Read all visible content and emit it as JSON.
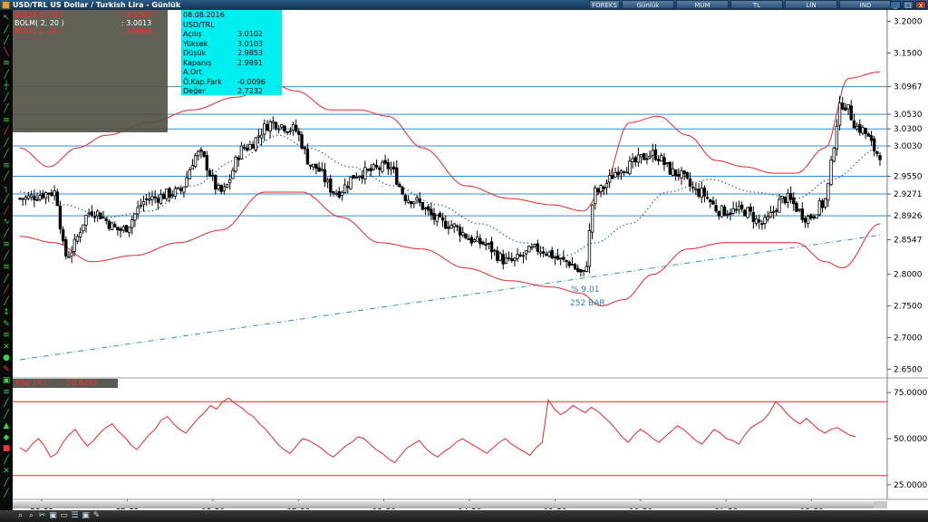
{
  "window": {
    "title": "USD/TRL US Dollar / Turkish Lira - Günlük",
    "toolbar_buttons": [
      "FOREKS",
      "Günlük",
      "MUM",
      "TL",
      "LIN",
      "IND"
    ],
    "window_controls": [
      "_",
      "□",
      "x"
    ]
  },
  "indicators_panel": {
    "rows": [
      {
        "label": "BOLH( 2, 20 )",
        "value": ": 3.1161"
      },
      {
        "label": "BOLM( 2, 20 )",
        "value": ": 3.0013"
      },
      {
        "label": "BOLL( 2, 20 )",
        "value": ": 2.8865"
      }
    ]
  },
  "data_window": {
    "date": "08.08.2016",
    "symbol": "USD/TRL",
    "rows": [
      {
        "label": "Açılış",
        "value": "3.0102"
      },
      {
        "label": "Yüksek",
        "value": "3.0103"
      },
      {
        "label": "Düşük",
        "value": "2.9853"
      },
      {
        "label": "Kapanış",
        "value": "2.9891"
      },
      {
        "label": "A.Ort",
        "value": ""
      },
      {
        "label": "Ö.Kap.Fark",
        "value": "-0.0096"
      },
      {
        "label": "Değer",
        "value": "2.7232"
      }
    ]
  },
  "rsi_legend": {
    "label": "RSI( 14 )",
    "value": "50.8293"
  },
  "chart_data": [
    {
      "type": "candlestick",
      "panel": "price",
      "x_categories": [
        "11-15",
        "12-15",
        "01-16",
        "02-16",
        "03-16",
        "04-16",
        "05-16",
        "06-16",
        "07-16",
        "08-16"
      ],
      "y_ticks": [
        3.2,
        3.15,
        3.0967,
        3.053,
        3.03,
        3.003,
        2.955,
        2.9271,
        2.8926,
        2.8547,
        2.8,
        2.75,
        2.7,
        2.65
      ],
      "ylim": [
        2.642,
        3.218
      ],
      "horizontal_levels": [
        3.0967,
        3.053,
        3.03,
        3.003,
        2.955,
        2.9271,
        2.8926
      ],
      "trendline": {
        "start": [
          0,
          2.665
        ],
        "end": [
          299,
          2.862
        ]
      },
      "annotations": [
        "% 9.01",
        "252 BAR"
      ],
      "series_key_points": {
        "close": [
          [
            0,
            2.92
          ],
          [
            12,
            2.93
          ],
          [
            16,
            2.83
          ],
          [
            25,
            2.9
          ],
          [
            35,
            2.87
          ],
          [
            45,
            2.92
          ],
          [
            55,
            2.93
          ],
          [
            62,
            2.99
          ],
          [
            70,
            2.93
          ],
          [
            78,
            3.0
          ],
          [
            88,
            3.04
          ],
          [
            95,
            3.03
          ],
          [
            102,
            2.97
          ],
          [
            110,
            2.93
          ],
          [
            118,
            2.96
          ],
          [
            128,
            2.97
          ],
          [
            135,
            2.92
          ],
          [
            148,
            2.88
          ],
          [
            160,
            2.85
          ],
          [
            170,
            2.82
          ],
          [
            180,
            2.84
          ],
          [
            190,
            2.82
          ],
          [
            196,
            2.8
          ],
          [
            200,
            2.93
          ],
          [
            210,
            2.97
          ],
          [
            220,
            2.99
          ],
          [
            228,
            2.96
          ],
          [
            236,
            2.93
          ],
          [
            244,
            2.9
          ],
          [
            252,
            2.9
          ],
          [
            258,
            2.88
          ],
          [
            266,
            2.92
          ],
          [
            274,
            2.89
          ],
          [
            279,
            2.91
          ],
          [
            286,
            3.07
          ],
          [
            292,
            3.03
          ],
          [
            299,
            2.99
          ]
        ],
        "bollinger_upper": [
          [
            0,
            3.0
          ],
          [
            10,
            2.97
          ],
          [
            20,
            3.0
          ],
          [
            30,
            3.02
          ],
          [
            45,
            3.04
          ],
          [
            60,
            3.06
          ],
          [
            75,
            3.08
          ],
          [
            88,
            3.1
          ],
          [
            96,
            3.09
          ],
          [
            108,
            3.06
          ],
          [
            118,
            3.06
          ],
          [
            128,
            3.05
          ],
          [
            140,
            3.0
          ],
          [
            155,
            2.94
          ],
          [
            170,
            2.92
          ],
          [
            185,
            2.91
          ],
          [
            196,
            2.9
          ],
          [
            202,
            2.93
          ],
          [
            212,
            3.04
          ],
          [
            222,
            3.05
          ],
          [
            232,
            3.02
          ],
          [
            242,
            2.98
          ],
          [
            252,
            2.97
          ],
          [
            262,
            2.96
          ],
          [
            270,
            2.96
          ],
          [
            280,
            3.0
          ],
          [
            288,
            3.11
          ],
          [
            299,
            3.12
          ]
        ],
        "bollinger_middle": [
          [
            0,
            2.93
          ],
          [
            15,
            2.91
          ],
          [
            30,
            2.89
          ],
          [
            45,
            2.9
          ],
          [
            60,
            2.94
          ],
          [
            75,
            2.98
          ],
          [
            90,
            3.02
          ],
          [
            100,
            3.0
          ],
          [
            115,
            2.97
          ],
          [
            130,
            2.94
          ],
          [
            145,
            2.91
          ],
          [
            160,
            2.88
          ],
          [
            175,
            2.85
          ],
          [
            190,
            2.83
          ],
          [
            200,
            2.85
          ],
          [
            212,
            2.88
          ],
          [
            225,
            2.93
          ],
          [
            240,
            2.95
          ],
          [
            255,
            2.93
          ],
          [
            270,
            2.92
          ],
          [
            282,
            2.95
          ],
          [
            299,
            3.0
          ]
        ],
        "bollinger_lower": [
          [
            0,
            2.86
          ],
          [
            12,
            2.85
          ],
          [
            25,
            2.82
          ],
          [
            40,
            2.83
          ],
          [
            55,
            2.85
          ],
          [
            70,
            2.87
          ],
          [
            85,
            2.93
          ],
          [
            98,
            2.93
          ],
          [
            112,
            2.89
          ],
          [
            125,
            2.85
          ],
          [
            140,
            2.84
          ],
          [
            155,
            2.81
          ],
          [
            170,
            2.79
          ],
          [
            185,
            2.78
          ],
          [
            195,
            2.77
          ],
          [
            202,
            2.75
          ],
          [
            210,
            2.76
          ],
          [
            220,
            2.8
          ],
          [
            232,
            2.84
          ],
          [
            245,
            2.85
          ],
          [
            258,
            2.85
          ],
          [
            270,
            2.85
          ],
          [
            280,
            2.82
          ],
          [
            286,
            2.81
          ],
          [
            299,
            2.88
          ]
        ]
      }
    },
    {
      "type": "line",
      "panel": "rsi",
      "series": [
        {
          "name": "RSI( 14 )",
          "values": [
            45,
            43,
            47,
            50,
            46,
            40,
            42,
            48,
            52,
            55,
            50,
            46,
            49,
            53,
            56,
            58,
            54,
            51,
            47,
            44,
            48,
            52,
            55,
            60,
            62,
            58,
            55,
            53,
            57,
            61,
            64,
            68,
            66,
            70,
            72,
            69,
            67,
            64,
            62,
            58,
            55,
            51,
            47,
            44,
            42,
            46,
            50,
            49,
            47,
            45,
            42,
            40,
            43,
            46,
            48,
            51,
            50,
            47,
            44,
            42,
            39,
            37,
            41,
            45,
            47,
            49,
            45,
            42,
            40,
            43,
            45,
            48,
            50,
            48,
            46,
            44,
            42,
            45,
            48,
            50,
            47,
            45,
            43,
            41,
            45,
            48,
            71,
            66,
            63,
            65,
            68,
            66,
            64,
            67,
            65,
            62,
            59,
            55,
            51,
            48,
            52,
            55,
            53,
            50,
            48,
            51,
            54,
            57,
            55,
            52,
            49,
            47,
            51,
            55,
            53,
            50,
            49,
            47,
            52,
            56,
            58,
            60,
            64,
            70,
            67,
            63,
            60,
            58,
            61,
            58,
            55,
            53,
            55,
            56,
            54,
            52,
            51
          ]
        }
      ],
      "y_ticks": [
        75,
        50,
        25
      ],
      "ylim": [
        22,
        78
      ],
      "horizontal_levels": [
        70,
        30
      ]
    }
  ]
}
